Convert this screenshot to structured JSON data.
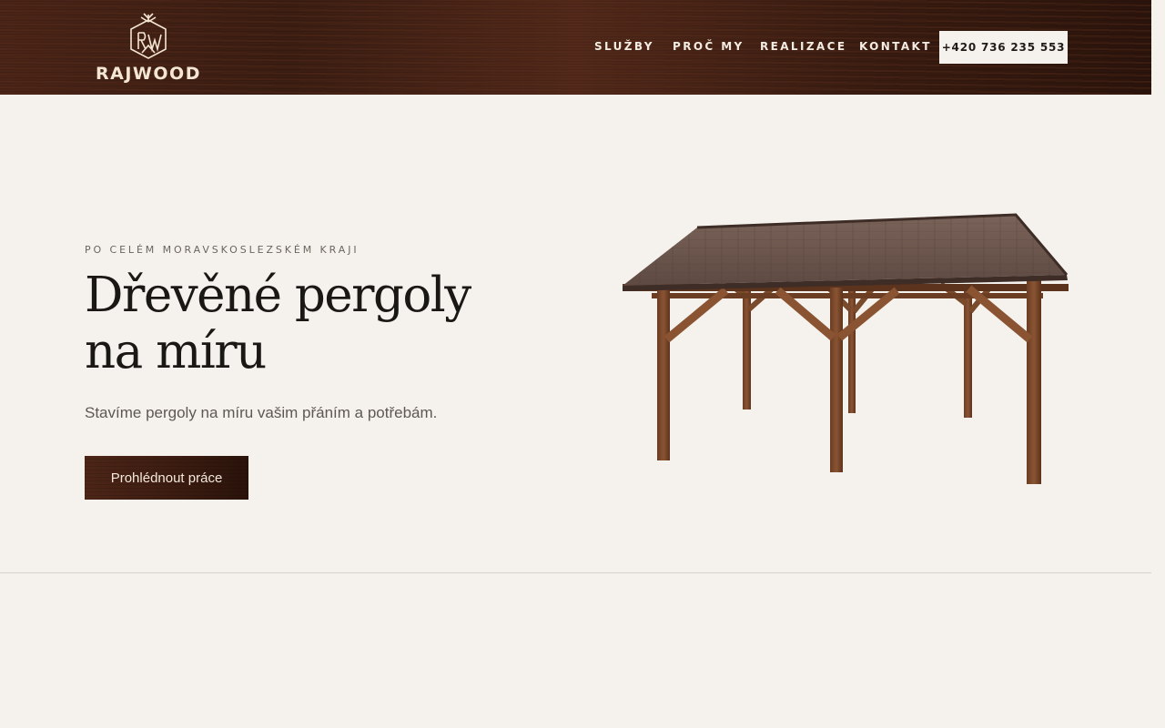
{
  "header": {
    "logo": {
      "monogram": "RW",
      "text": "RAJWOOD"
    },
    "nav": {
      "items": [
        {
          "label": "SLUŽBY"
        },
        {
          "label": "PROČ MY"
        },
        {
          "label": "REALIZACE"
        },
        {
          "label": "KONTAKT"
        }
      ]
    },
    "phone": "+420 736 235 553"
  },
  "hero": {
    "eyebrow": "PO CELÉM MORAVSKOSLEZSKÉM KRAJI",
    "title_line1": "Dřevěné pergoly",
    "title_line2": "na míru",
    "subtitle": "Stavíme pergoly na míru vašim přáním a potřebám.",
    "cta_label": "Prohlédnout práce",
    "image_icon": "pergola-image"
  },
  "colors": {
    "page_bg": "#f5f2ed",
    "header_wood": "#3b1d12",
    "text_dark": "#1a1815",
    "text_muted": "#5e5852"
  }
}
